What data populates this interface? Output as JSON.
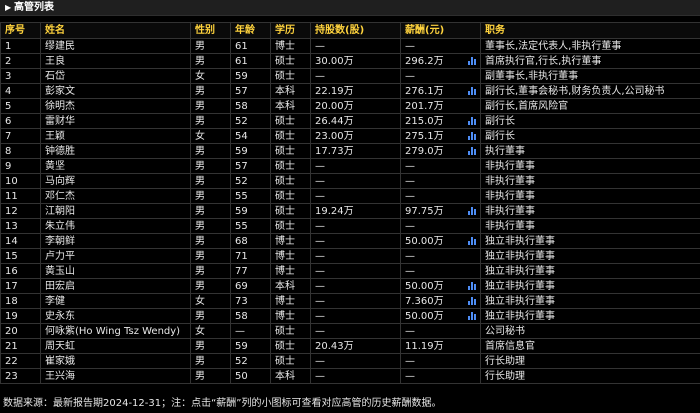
{
  "panel": {
    "title": "高管列表"
  },
  "columns": [
    "序号",
    "姓名",
    "性别",
    "年龄",
    "学历",
    "持股数(股)",
    "薪酬(元)",
    "职务"
  ],
  "rows": [
    {
      "no": "1",
      "name": "缪建民",
      "gender": "男",
      "age": "61",
      "edu": "博士",
      "shares": "—",
      "salary": "—",
      "chart": false,
      "title": "董事长,法定代表人,非执行董事"
    },
    {
      "no": "2",
      "name": "王良",
      "gender": "男",
      "age": "61",
      "edu": "硕士",
      "shares": "30.00万",
      "salary": "296.2万",
      "chart": true,
      "title": "首席执行官,行长,执行董事"
    },
    {
      "no": "3",
      "name": "石岱",
      "gender": "女",
      "age": "59",
      "edu": "硕士",
      "shares": "—",
      "salary": "—",
      "chart": false,
      "title": "副董事长,非执行董事"
    },
    {
      "no": "4",
      "name": "彭家文",
      "gender": "男",
      "age": "57",
      "edu": "本科",
      "shares": "22.19万",
      "salary": "276.1万",
      "chart": true,
      "title": "副行长,董事会秘书,财务负责人,公司秘书"
    },
    {
      "no": "5",
      "name": "徐明杰",
      "gender": "男",
      "age": "58",
      "edu": "本科",
      "shares": "20.00万",
      "salary": "201.7万",
      "chart": false,
      "title": "副行长,首席风险官"
    },
    {
      "no": "6",
      "name": "雷财华",
      "gender": "男",
      "age": "52",
      "edu": "硕士",
      "shares": "26.44万",
      "salary": "215.0万",
      "chart": true,
      "title": "副行长"
    },
    {
      "no": "7",
      "name": "王颖",
      "gender": "女",
      "age": "54",
      "edu": "硕士",
      "shares": "23.00万",
      "salary": "275.1万",
      "chart": true,
      "title": "副行长"
    },
    {
      "no": "8",
      "name": "钟德胜",
      "gender": "男",
      "age": "59",
      "edu": "硕士",
      "shares": "17.73万",
      "salary": "279.0万",
      "chart": true,
      "title": "执行董事"
    },
    {
      "no": "9",
      "name": "黄坚",
      "gender": "男",
      "age": "57",
      "edu": "硕士",
      "shares": "—",
      "salary": "—",
      "chart": false,
      "title": "非执行董事"
    },
    {
      "no": "10",
      "name": "马向辉",
      "gender": "男",
      "age": "52",
      "edu": "硕士",
      "shares": "—",
      "salary": "—",
      "chart": false,
      "title": "非执行董事"
    },
    {
      "no": "11",
      "name": "邓仁杰",
      "gender": "男",
      "age": "55",
      "edu": "硕士",
      "shares": "—",
      "salary": "—",
      "chart": false,
      "title": "非执行董事"
    },
    {
      "no": "12",
      "name": "江朝阳",
      "gender": "男",
      "age": "59",
      "edu": "硕士",
      "shares": "19.24万",
      "salary": "97.75万",
      "chart": true,
      "title": "非执行董事"
    },
    {
      "no": "13",
      "name": "朱立伟",
      "gender": "男",
      "age": "55",
      "edu": "硕士",
      "shares": "—",
      "salary": "—",
      "chart": false,
      "title": "非执行董事"
    },
    {
      "no": "14",
      "name": "李朝鲜",
      "gender": "男",
      "age": "68",
      "edu": "博士",
      "shares": "—",
      "salary": "50.00万",
      "chart": true,
      "title": "独立非执行董事"
    },
    {
      "no": "15",
      "name": "卢力平",
      "gender": "男",
      "age": "71",
      "edu": "博士",
      "shares": "—",
      "salary": "—",
      "chart": false,
      "title": "独立非执行董事"
    },
    {
      "no": "16",
      "name": "黄玉山",
      "gender": "男",
      "age": "77",
      "edu": "博士",
      "shares": "—",
      "salary": "—",
      "chart": false,
      "title": "独立非执行董事"
    },
    {
      "no": "17",
      "name": "田宏启",
      "gender": "男",
      "age": "69",
      "edu": "本科",
      "shares": "—",
      "salary": "50.00万",
      "chart": true,
      "title": "独立非执行董事"
    },
    {
      "no": "18",
      "name": "李健",
      "gender": "女",
      "age": "73",
      "edu": "博士",
      "shares": "—",
      "salary": "7.360万",
      "chart": true,
      "title": "独立非执行董事"
    },
    {
      "no": "19",
      "name": "史永东",
      "gender": "男",
      "age": "58",
      "edu": "博士",
      "shares": "—",
      "salary": "50.00万",
      "chart": true,
      "title": "独立非执行董事"
    },
    {
      "no": "20",
      "name": "何咏紫(Ho Wing Tsz Wendy)",
      "gender": "女",
      "age": "—",
      "edu": "硕士",
      "shares": "—",
      "salary": "—",
      "chart": false,
      "title": "公司秘书"
    },
    {
      "no": "21",
      "name": "周天虹",
      "gender": "男",
      "age": "59",
      "edu": "硕士",
      "shares": "20.43万",
      "salary": "11.19万",
      "chart": false,
      "title": "首席信息官"
    },
    {
      "no": "22",
      "name": "崔家娥",
      "gender": "男",
      "age": "52",
      "edu": "硕士",
      "shares": "—",
      "salary": "—",
      "chart": false,
      "title": "行长助理"
    },
    {
      "no": "23",
      "name": "王兴海",
      "gender": "男",
      "age": "50",
      "edu": "本科",
      "shares": "—",
      "salary": "—",
      "chart": false,
      "title": "行长助理"
    }
  ],
  "footer": "数据来源：最新报告期2024-12-31；注：点击“薪酬”列的小图标可查看对应高管的历史薪酬数据。",
  "colors": {
    "header": "#ffd33d",
    "icon": "#4e8df5",
    "grid": "#333333"
  }
}
